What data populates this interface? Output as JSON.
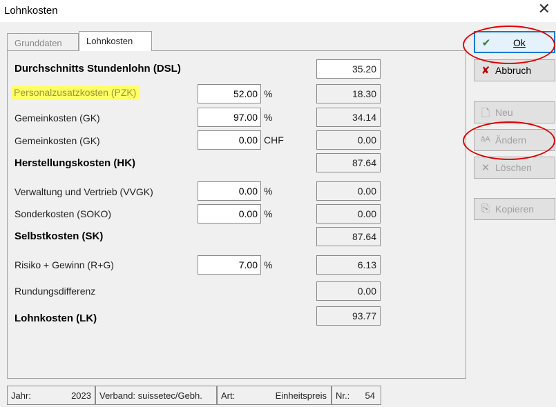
{
  "window": {
    "title": "Lohnkosten",
    "close_glyph": "✕"
  },
  "tabs": [
    {
      "label": "Grunddaten",
      "active": false
    },
    {
      "label": "Lohnkosten",
      "active": true
    }
  ],
  "rows": {
    "dsl": {
      "label": "Durchschnitts Stundenlohn (DSL)",
      "result": "35.20"
    },
    "pzk": {
      "label": "Personalzusatzkosten (PZK)",
      "input": "52.00",
      "unit": "%",
      "result": "18.30"
    },
    "gk_pct": {
      "label": "Gemeinkosten (GK)",
      "input": "97.00",
      "unit": "%",
      "result": "34.14"
    },
    "gk_chf": {
      "label": "Gemeinkosten (GK)",
      "input": "0.00",
      "unit": "CHF",
      "result": "0.00"
    },
    "hk": {
      "label": "Herstellungskosten (HK)",
      "result": "87.64"
    },
    "vvgk": {
      "label": "Verwaltung und Vertrieb (VVGK)",
      "input": "0.00",
      "unit": "%",
      "result": "0.00"
    },
    "soko": {
      "label": "Sonderkosten (SOKO)",
      "input": "0.00",
      "unit": "%",
      "result": "0.00"
    },
    "sk": {
      "label": "Selbstkosten (SK)",
      "result": "87.64"
    },
    "rg": {
      "label": "Risiko + Gewinn (R+G)",
      "input": "7.00",
      "unit": "%",
      "result": "6.13"
    },
    "rund": {
      "label": "Rundungsdifferenz",
      "result": "0.00"
    },
    "lk": {
      "label": "Lohnkosten (LK)",
      "result": "93.77"
    }
  },
  "buttons": {
    "ok": {
      "label": "Ok",
      "icon": "✔"
    },
    "abbruch": {
      "label": "Abbruch",
      "icon": "✘"
    },
    "neu": {
      "label": "Neu",
      "icon": "🗋"
    },
    "aendern": {
      "label": "Ändern",
      "icon": "āA"
    },
    "loeschen": {
      "label": "Löschen",
      "icon": "✕"
    },
    "kopieren": {
      "label": "Kopieren",
      "icon": "⎘"
    }
  },
  "status": {
    "jahr_label": "Jahr:",
    "jahr_value": "2023",
    "verband": "Verband: suissetec/Gebh.",
    "art_label": "Art:",
    "art_value": "Einheitspreis",
    "nr_label": "Nr.:",
    "nr_value": "54"
  },
  "colors": {
    "ok_check": "#2e7d32",
    "abbruch_x": "#c00000",
    "highlight": "#ffff66",
    "annotation_ring": "#e00000"
  }
}
